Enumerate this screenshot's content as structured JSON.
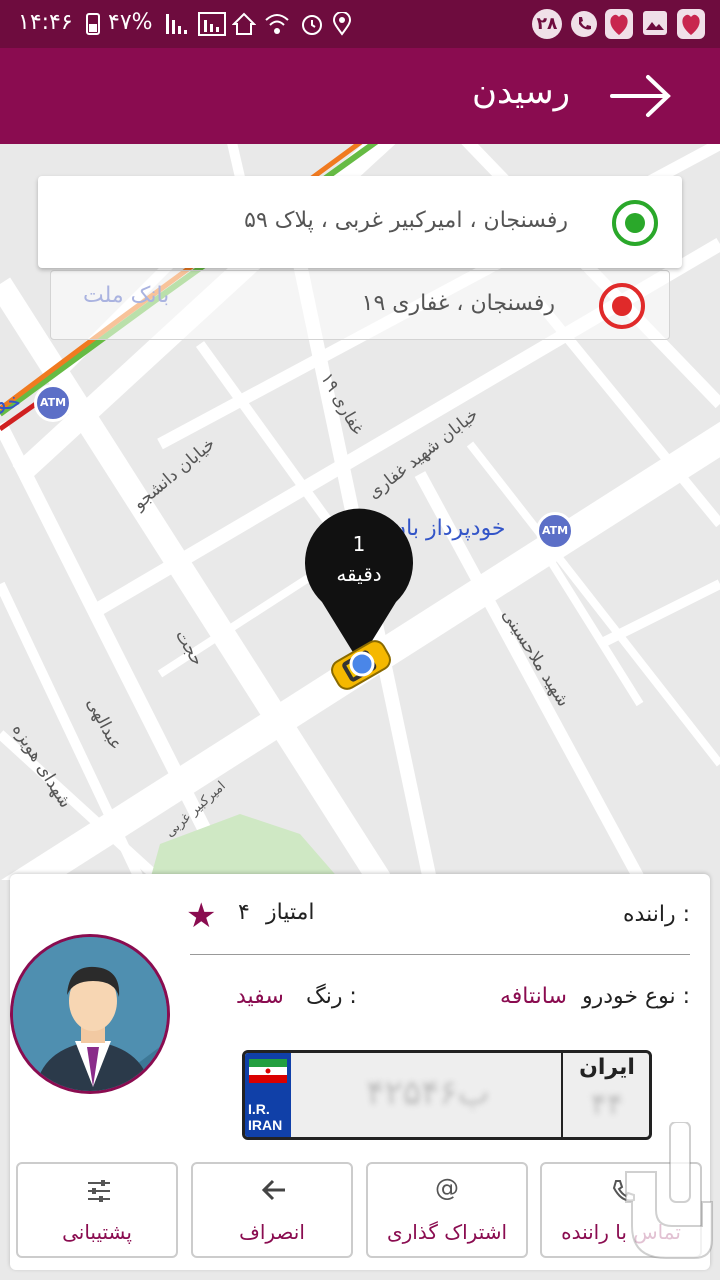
{
  "status_bar": {
    "time": "۱۴:۴۶",
    "battery": "۴۷%",
    "notification_count": "۲۸"
  },
  "header": {
    "title": "رسیدن"
  },
  "addresses": {
    "origin": "رفسنجان ، امیرکبیر غربی ، پلاک ۵۹",
    "destination": "رفسنجان ، غفاری ۱۹",
    "origin_color": "#2aa82a",
    "destination_color": "#e02a2a"
  },
  "map": {
    "labels": {
      "bank_mellat": "بانک ملت",
      "atm": "ATM",
      "khodpardaz": "خودپرداز بان",
      "ghaffari19": "غفاری ۱۹",
      "shahid_ghaffari": "خیابان شهید غفاری",
      "daneshjoo": "خیابان دانشجو",
      "hojjat": "حجت",
      "abdolahi": "عبدالهی",
      "shohadaye_hovayzeh": "شهدای هویزه",
      "amirkabir": "امیرکبیر غربی",
      "mollahosseini": "شهید ملاحسینی",
      "ghaffari_short": "غفاری ۱۹"
    },
    "eta_value": "1",
    "eta_unit": "دقیقه"
  },
  "driver": {
    "driver_label": "راننده :",
    "rating_label": "امتیاز",
    "rating_value": "۴",
    "vehicle_label": "نوع خودرو :",
    "vehicle_value": "سانتافه",
    "color_label": "رنگ :",
    "color_value": "سفید",
    "plate_number": "۴۲ب۵۴۶",
    "plate_country": "ایران",
    "plate_code": "۴۴",
    "plate_iri": "I.R.",
    "plate_iran": "IRAN"
  },
  "actions": [
    {
      "label": "تماس با راننده",
      "icon": "phone-icon"
    },
    {
      "label": "اشتراک گذاری",
      "icon": "at-icon"
    },
    {
      "label": "انصراف",
      "icon": "back-arrow-icon"
    },
    {
      "label": "پشتیبانی",
      "icon": "settings-sliders-icon"
    }
  ],
  "colors": {
    "primary": "#8a0c50",
    "status_bar": "#6e0c3e"
  }
}
